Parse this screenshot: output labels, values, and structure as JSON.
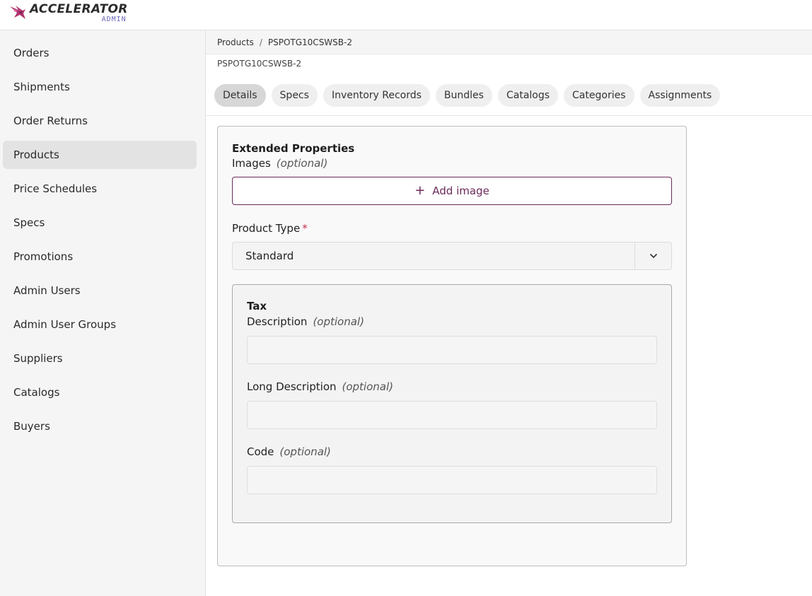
{
  "brand": {
    "title": "ACCELERATOR",
    "subtitle": "ADMIN",
    "logo_icon": "bird-logo-icon",
    "accent_color": "#b0346f",
    "sub_color": "#6a67b8"
  },
  "sidebar": {
    "items": [
      {
        "label": "Orders",
        "active": false
      },
      {
        "label": "Shipments",
        "active": false
      },
      {
        "label": "Order Returns",
        "active": false
      },
      {
        "label": "Products",
        "active": true
      },
      {
        "label": "Price Schedules",
        "active": false
      },
      {
        "label": "Specs",
        "active": false
      },
      {
        "label": "Promotions",
        "active": false
      },
      {
        "label": "Admin Users",
        "active": false
      },
      {
        "label": "Admin User Groups",
        "active": false
      },
      {
        "label": "Suppliers",
        "active": false
      },
      {
        "label": "Catalogs",
        "active": false
      },
      {
        "label": "Buyers",
        "active": false
      }
    ]
  },
  "breadcrumb": {
    "items": [
      "Products",
      "PSPOTG10CSWSB-2"
    ],
    "separator": "/"
  },
  "page": {
    "subtitle": "PSPOTG10CSWSB-2"
  },
  "tabs": [
    {
      "label": "Details",
      "active": true
    },
    {
      "label": "Specs",
      "active": false
    },
    {
      "label": "Inventory Records",
      "active": false
    },
    {
      "label": "Bundles",
      "active": false
    },
    {
      "label": "Catalogs",
      "active": false
    },
    {
      "label": "Categories",
      "active": false
    },
    {
      "label": "Assignments",
      "active": false
    }
  ],
  "form": {
    "section_title": "Extended Properties",
    "images": {
      "label": "Images",
      "optional": "(optional)",
      "button": "Add image",
      "button_icon": "plus-icon",
      "button_color": "#6b2a59"
    },
    "product_type": {
      "label": "Product Type",
      "required_mark": "*",
      "value": "Standard",
      "icon": "chevron-down-icon"
    },
    "tax": {
      "title": "Tax",
      "description": {
        "label": "Description",
        "optional": "(optional)",
        "value": ""
      },
      "long_description": {
        "label": "Long Description",
        "optional": "(optional)",
        "value": ""
      },
      "code": {
        "label": "Code",
        "optional": "(optional)",
        "value": ""
      }
    }
  }
}
